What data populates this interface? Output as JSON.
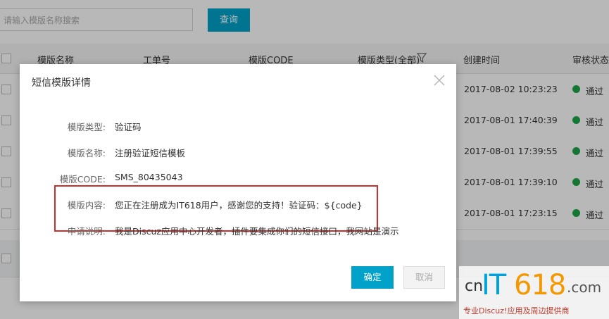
{
  "search": {
    "placeholder": "请输入模版名称搜索",
    "button_label": "查询"
  },
  "table": {
    "headers": {
      "name": "模版名称",
      "ticket": "工单号",
      "code": "模版CODE",
      "type": "模版类型(全部)",
      "created": "创建时间",
      "status": "审核状态("
    },
    "rows": [
      {
        "created": "2017-08-02 10:23:23",
        "status": "通过"
      },
      {
        "created": "2017-08-01 17:40:39",
        "status": "通过"
      },
      {
        "created": "2017-08-01 17:39:55",
        "status": "通过"
      },
      {
        "created": "2017-08-01 17:39:10",
        "status": "通过"
      },
      {
        "created": "2017-08-01 17:23:15",
        "status": "通过"
      }
    ]
  },
  "modal": {
    "title": "短信模版详情",
    "fields": [
      {
        "label": "模版类型:",
        "value": "验证码"
      },
      {
        "label": "模版名称:",
        "value": "注册验证短信模板"
      },
      {
        "label": "模版CODE:",
        "value": "SMS_80435043"
      },
      {
        "label": "模版内容:",
        "value": "您正在注册成为IT618用户，感谢您的支持！验证码：${code}"
      },
      {
        "label": "申请说明:",
        "value": "我是Discuz应用中心开发者，插件要集成你们的短信接口，我网站是演示"
      }
    ],
    "confirm_label": "确定",
    "cancel_label": "取消"
  },
  "watermark": {
    "prefix": "cn",
    "brand_it": "IT",
    "brand_num": "618",
    "suffix": ".com",
    "tagline": "专业Discuz!应用及周边提供商"
  },
  "colors": {
    "accent": "#00a2ca",
    "status_ok": "#1fa64a",
    "highlight": "#c9302c"
  }
}
